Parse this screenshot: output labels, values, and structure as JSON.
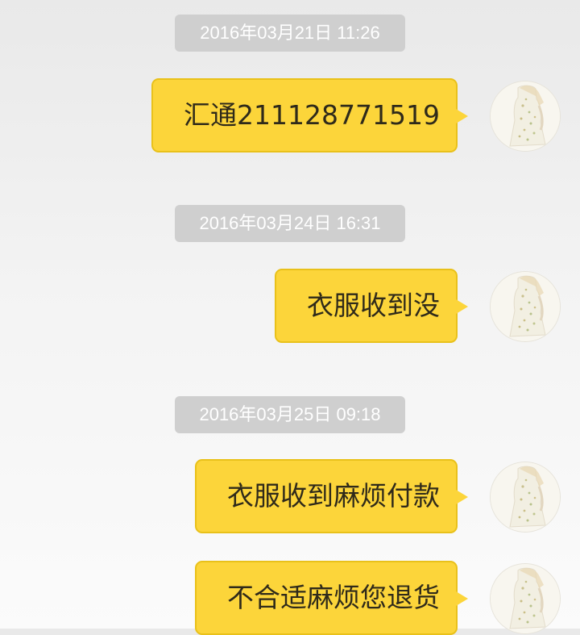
{
  "messages": [
    {
      "timestamp": "2016年03月21日 11:26",
      "text": "汇通211128771519",
      "from": "me"
    },
    {
      "timestamp": "2016年03月24日 16:31",
      "text": "衣服收到没",
      "from": "me"
    },
    {
      "timestamp": "2016年03月25日 09:18",
      "text": "衣服收到麻烦付款",
      "from": "me"
    },
    {
      "timestamp": "",
      "text": "不合适麻烦您退货",
      "from": "me"
    }
  ],
  "colors": {
    "bubble": "#fcd53a",
    "bubble_border": "#e9c11a",
    "timestamp_bg": "#cfcfcf",
    "timestamp_text": "#ffffff",
    "background": "#efefef"
  },
  "icons": {
    "avatar": "avatar-dress-icon"
  }
}
